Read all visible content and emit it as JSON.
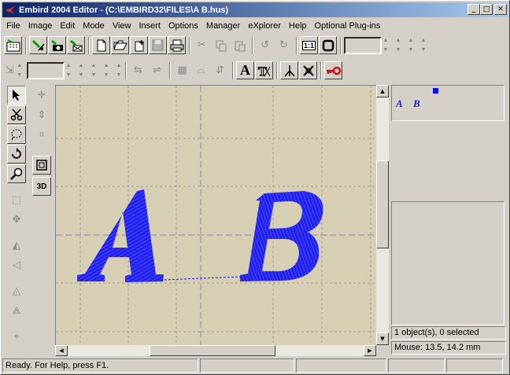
{
  "window": {
    "title": "Embird 2004 Editor - (C:\\EMBIRD32\\FILES\\A  B.hus)",
    "minimize_glyph": "_",
    "maximize_glyph": "□",
    "close_glyph": "✕"
  },
  "menu": [
    "File",
    "Image",
    "Edit",
    "Mode",
    "View",
    "Insert",
    "Options",
    "Manager",
    "eXplorer",
    "Help",
    "Optional Plug-ins"
  ],
  "toolbar": {
    "scale_label": "1:1",
    "text_tool_glyph": "A",
    "view_3d_label": "3D"
  },
  "canvas": {
    "letters": [
      "A",
      "B"
    ],
    "stitch_color": "#1010e0",
    "background_color": "#d6cfb4"
  },
  "status": {
    "ready_text": "Ready. For Help, press F1.",
    "selection_text": "1 object(s), 0 selected",
    "mouse_text": "Mouse: 13.5, 14.2 mm"
  },
  "colors": {
    "title_start": "#0a246a",
    "title_end": "#a6caf0",
    "accent_red": "#d01010"
  }
}
